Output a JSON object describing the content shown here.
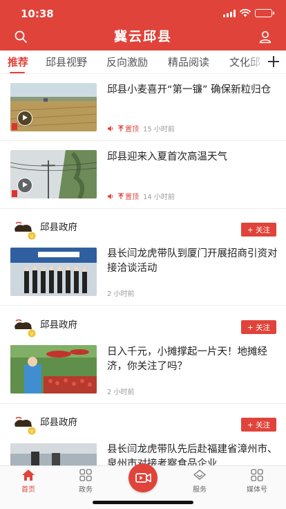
{
  "status": {
    "time": "10:38"
  },
  "header": {
    "title": "冀云邱县",
    "colors": {
      "brand": "#e0433a"
    }
  },
  "tabs": [
    {
      "label": "推荐",
      "active": true
    },
    {
      "label": "邱县视野"
    },
    {
      "label": "反向激励"
    },
    {
      "label": "精品阅读"
    },
    {
      "label": "文化邱"
    }
  ],
  "feed": {
    "items": [
      {
        "title": "邱县小麦喜开“第一镰” 确保新粒归仓",
        "pin": "置顶",
        "time": "15 小时前"
      },
      {
        "title": "邱县迎来入夏首次高温天气",
        "pin": "置顶",
        "time": "14 小时前"
      }
    ],
    "accounts": [
      {
        "name": "邱县政府",
        "follow": "+ 关注",
        "title": "县长闫龙虎带队到厦门开展招商引资对接洽谈活动",
        "time": "2 小时前"
      },
      {
        "name": "邱县政府",
        "follow": "+ 关注",
        "title": "日入千元，小摊撑起一片天！地摊经济，你关注了吗？",
        "time": "2 小时前"
      },
      {
        "name": "邱县政府",
        "follow": "+ 关注",
        "title": "县长闫龙虎带队先后赴福建省漳州市、泉州市对接考察食品企业"
      }
    ]
  },
  "bottom_nav": [
    {
      "label": "首页",
      "active": true,
      "icon": "home-icon"
    },
    {
      "label": "政务",
      "icon": "grid-icon"
    },
    {
      "label": "",
      "icon": "video-camera-icon"
    },
    {
      "label": "服务",
      "icon": "diamond-icon"
    },
    {
      "label": "媒体号",
      "icon": "grid-icon"
    }
  ]
}
